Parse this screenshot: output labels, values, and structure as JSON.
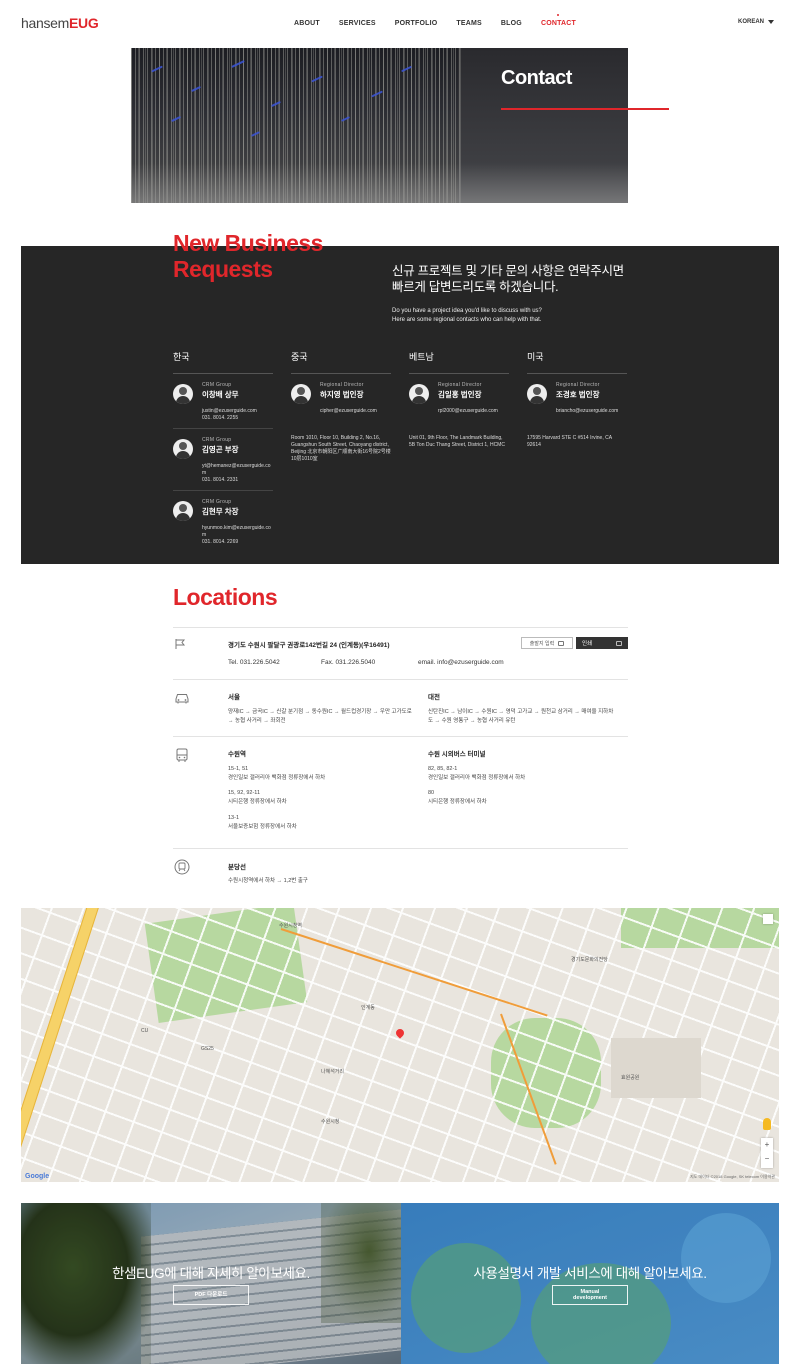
{
  "header": {
    "logo_light": "hansem",
    "logo_bold": "EUG",
    "nav": [
      "ABOUT",
      "SERVICES",
      "PORTFOLIO",
      "TEAMS",
      "BLOG",
      "CONTACT"
    ],
    "active_nav": "CONTACT",
    "language": "KOREAN"
  },
  "hero": {
    "title": "Contact"
  },
  "new_business": {
    "title_line1": "New Business",
    "title_line2": "Requests",
    "desc_line1": "신규 프로젝트 및 기타 문의 사항은 연락주시면",
    "desc_line2": "빠르게 답변드리도록 하겠습니다.",
    "sub_line1": "Do you have a project idea you'd like to discuss with us?",
    "sub_line2": "Here are some regional contacts who can help with that.",
    "regions": [
      {
        "name": "한국",
        "people": [
          {
            "role": "CRM Group",
            "name": "이창배 상무",
            "email": "justin@ezuserguide.com",
            "tel": "031. 8014. 2255"
          },
          {
            "role": "CRM Group",
            "name": "김영곤 부장",
            "email": "yt@hemanez@ezuserguide.com",
            "tel": "031. 8014. 2331"
          },
          {
            "role": "CRM Group",
            "name": "김현무 차장",
            "email": "hyunmoo.kim@ezuserguide.com",
            "tel": "031. 8014. 2269"
          }
        ]
      },
      {
        "name": "중국",
        "people": [
          {
            "role": "Regional Director",
            "name": "하지영 법인장",
            "email": "cipher@ezuserguide.com",
            "address": "Room 1010, Floor 10, Building 2, No.16, Guangshun South Street, Chaoyang district, Beijing 北京市朝阳区广顺南大街16号院2号楼10层1010室"
          }
        ]
      },
      {
        "name": "베트남",
        "people": [
          {
            "role": "Regional Director",
            "name": "김일홍 법인장",
            "email": "rpl2000@ezuserguide.com",
            "address": "Unit 01, 9th Floor, The Landmark Building, 5B Ton Duc Thang Street, District 1, HCMC"
          }
        ]
      },
      {
        "name": "미국",
        "people": [
          {
            "role": "Regional Director",
            "name": "조경호 법인장",
            "email": "briancho@ezuserguide.com",
            "address": "17595 Harvard STE C #514 Irvine, CA 92614"
          }
        ]
      }
    ]
  },
  "locations": {
    "title": "Locations",
    "hq_address": "경기도 수원시 팔달구 권광로142번길 24 (인계동)(우16491)",
    "tel": "Tel. 031.226.5042",
    "fax": "Fax. 031.226.5040",
    "email": "email. info@ezuserguide.com",
    "print_label": "출발지 입력",
    "print2_label": "인쇄",
    "car": {
      "seoul_title": "서울",
      "seoul_text": "양재IC → 금곡IC → 신갈 분기점 → 동수원IC → 월드컵경기장 → 우만 고가도로 → 농협 사거리 → 좌회전",
      "daejeon_title": "대전",
      "daejeon_text": "신탄진IC → 남이IC → 수원IC → 영덕 고가교 → 원천교 삼거리 → 매여울 지하차도 → 수원 영통구 → 농협 사거리 유턴"
    },
    "bus": {
      "station_title": "수원역",
      "station_lines": [
        {
          "no": "15-1, 51",
          "desc": "경인일보 갤러리아 백화점 정류장에서 하차"
        },
        {
          "no": "15, 92, 92-11",
          "desc": "시티은행 정류장에서 하차"
        },
        {
          "no": "13-1",
          "desc": "서울보증보험 정류장에서 하차"
        }
      ],
      "terminal_title": "수원 시외버스 터미널",
      "terminal_lines": [
        {
          "no": "82, 85, 82-1",
          "desc": "경인일보 갤러리아 백화점 정류장에서 하차"
        },
        {
          "no": "80",
          "desc": "시티은행 정류장에서 하차"
        }
      ]
    },
    "subway": {
      "title": "분당선",
      "text": "수원시청역에서 하차 → 1,2번 출구"
    }
  },
  "map": {
    "labels": [
      "수원시청역",
      "경기도문화의전당",
      "인계동",
      "효원공원",
      "나혜석거리",
      "수원시청",
      "CU",
      "GS25"
    ],
    "google": "Google",
    "attribution": "지도 데이터 ©2018 Google, SK telecom 이용약관"
  },
  "banners": {
    "left_text": "한샘EUG에 대해 자세히 알아보세요.",
    "left_button": "PDF 다운로드",
    "right_text": "사용설명서 개발 서비스에 대해 알아보세요.",
    "right_button_line1": "Manual",
    "right_button_line2": "development"
  }
}
